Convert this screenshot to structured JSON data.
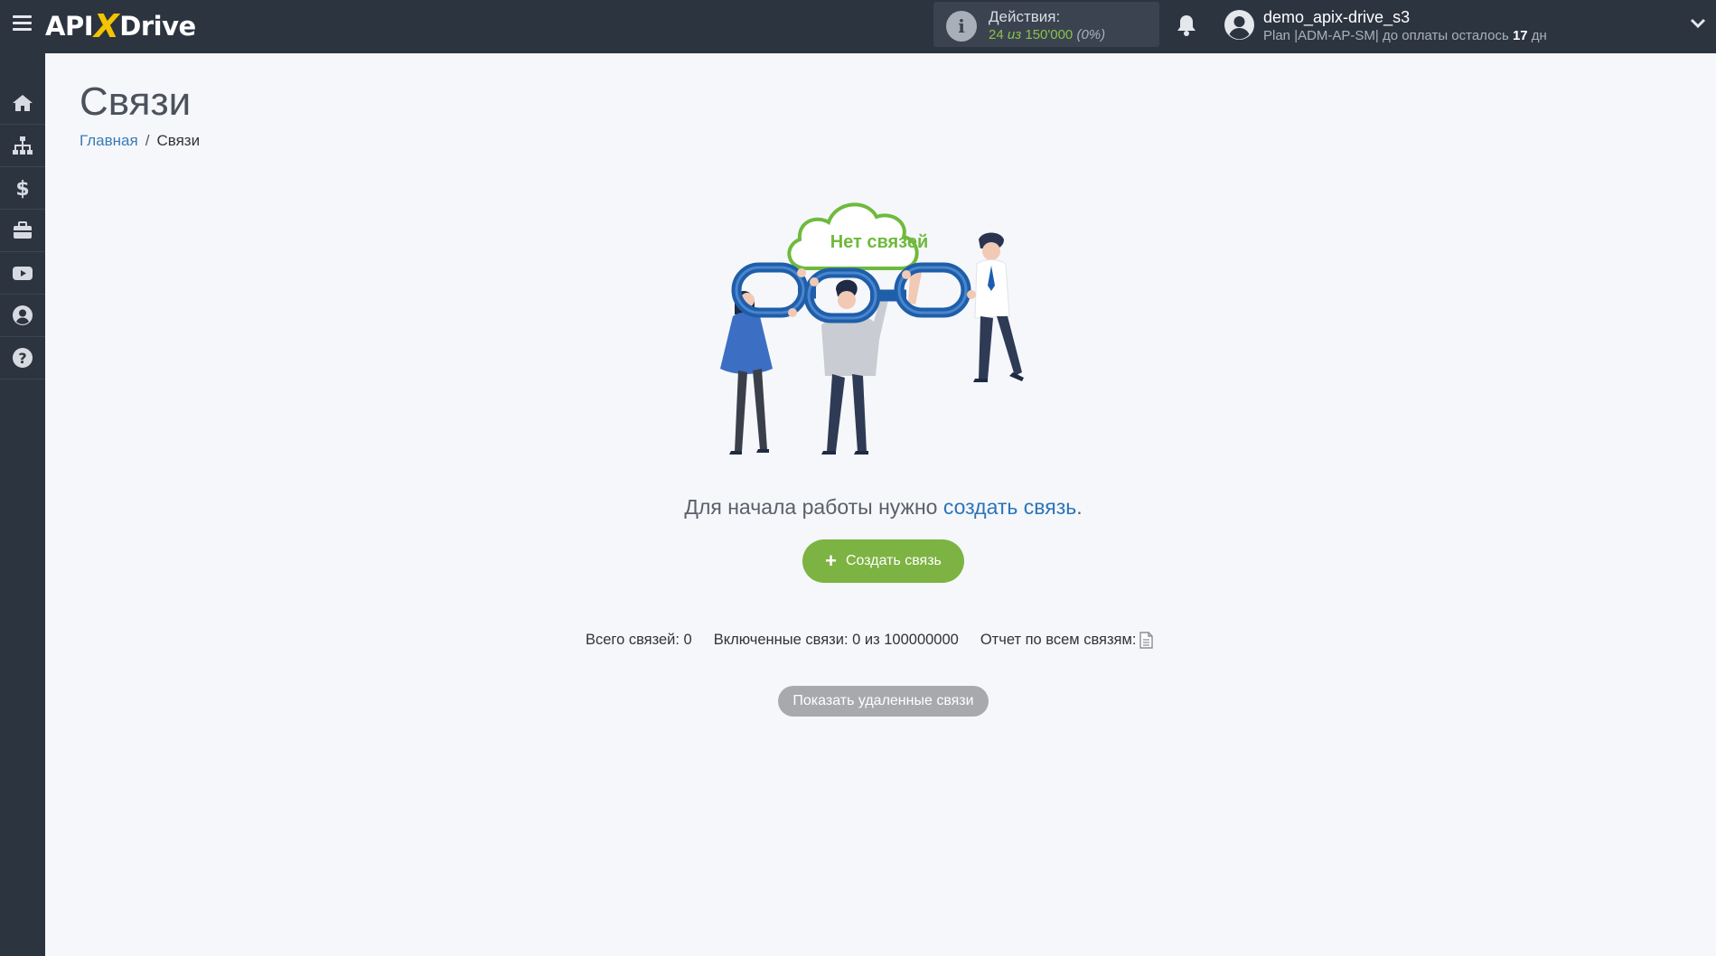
{
  "header": {
    "logo_prefix": "API",
    "logo_x": "X",
    "logo_suffix": "Drive",
    "actions_label": "Действия:",
    "actions_used": "24",
    "actions_of": "из",
    "actions_total": "150'000",
    "actions_pct": "(0%)",
    "user_name": "demo_apix-drive_s3",
    "user_plan": "Plan |ADM-AP-SM| до оплаты осталось",
    "days_left": "17",
    "days_unit": "дн"
  },
  "sidebar": {
    "items": [
      {
        "icon": "home-icon"
      },
      {
        "icon": "sitemap-icon"
      },
      {
        "icon": "dollar-icon"
      },
      {
        "icon": "briefcase-icon"
      },
      {
        "icon": "youtube-icon"
      },
      {
        "icon": "user-circle-icon"
      },
      {
        "icon": "question-circle-icon"
      }
    ]
  },
  "page": {
    "title": "Связи",
    "breadcrumb_home": "Главная",
    "breadcrumb_sep": "/",
    "breadcrumb_current": "Связи"
  },
  "illustration": {
    "cloud_text": "Нет связей"
  },
  "empty_state": {
    "hint_text": "Для начала работы нужно",
    "hint_link": "создать связь",
    "hint_end": ".",
    "create_button": "Создать связь",
    "create_plus": "+"
  },
  "stats": {
    "total": "Всего связей: 0",
    "enabled": "Включенные связи: 0 из 100000000",
    "report": "Отчет по всем связям:"
  },
  "deleted_button": "Показать удаленные связи",
  "colors": {
    "topbar": "#2c3440",
    "accent_green": "#7cb342",
    "link_blue": "#2b74b8",
    "chain_blue": "#1f5ea8"
  }
}
